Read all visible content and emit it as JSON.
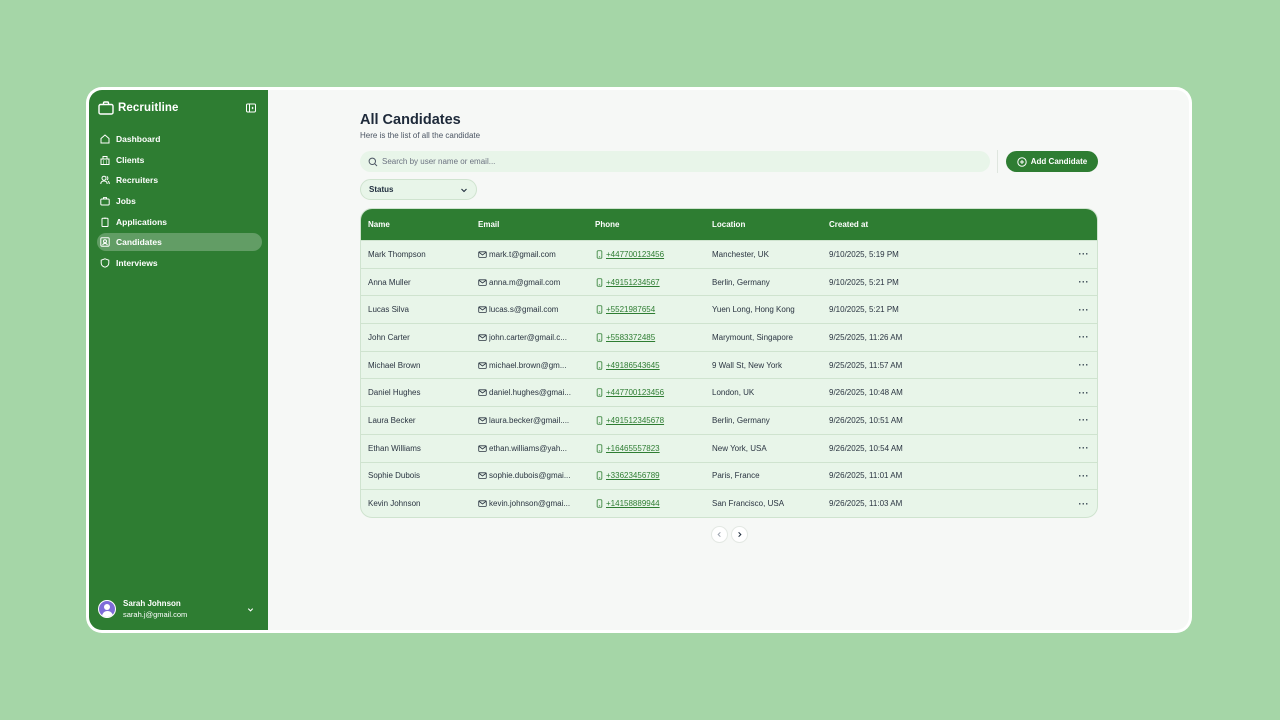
{
  "app": {
    "name": "Recruitline"
  },
  "sidebar": {
    "items": [
      {
        "label": "Dashboard",
        "icon": "home-icon"
      },
      {
        "label": "Clients",
        "icon": "building-icon"
      },
      {
        "label": "Recruiters",
        "icon": "users-icon"
      },
      {
        "label": "Jobs",
        "icon": "briefcase-icon"
      },
      {
        "label": "Applications",
        "icon": "clipboard-icon"
      },
      {
        "label": "Candidates",
        "icon": "contact-card-icon",
        "active": true
      },
      {
        "label": "Interviews",
        "icon": "shield-icon"
      }
    ]
  },
  "user": {
    "name": "Sarah Johnson",
    "email": "sarah.j@gmail.com"
  },
  "page": {
    "title": "All Candidates",
    "subtitle": "Here is the list of all the candidate",
    "search_placeholder": "Search by user name or email...",
    "add_button": "Add Candidate",
    "status_filter": "Status"
  },
  "table": {
    "headers": {
      "name": "Name",
      "email": "Email",
      "phone": "Phone",
      "location": "Location",
      "created": "Created at"
    },
    "rows": [
      {
        "name": "Mark Thompson",
        "email": "mark.t@gmail.com",
        "phone": "+447700123456",
        "location": "Manchester, UK",
        "created": "9/10/2025, 5:19 PM"
      },
      {
        "name": "Anna Muller",
        "email": "anna.m@gmail.com",
        "phone": "+49151234567",
        "location": "Berlin, Germany",
        "created": "9/10/2025, 5:21 PM"
      },
      {
        "name": "Lucas Silva",
        "email": "lucas.s@gmail.com",
        "phone": "+5521987654",
        "location": "Yuen Long, Hong Kong",
        "created": "9/10/2025, 5:21 PM"
      },
      {
        "name": "John Carter",
        "email": "john.carter@gmail.c...",
        "phone": "+5583372485",
        "location": "Marymount, Singapore",
        "created": "9/25/2025, 11:26 AM"
      },
      {
        "name": "Michael Brown",
        "email": "michael.brown@gm...",
        "phone": "+49186543645",
        "location": "9 Wall St, New York",
        "created": "9/25/2025, 11:57 AM"
      },
      {
        "name": "Daniel Hughes",
        "email": "daniel.hughes@gmai...",
        "phone": "+447700123456",
        "location": "London, UK",
        "created": "9/26/2025, 10:48 AM"
      },
      {
        "name": "Laura Becker",
        "email": "laura.becker@gmail....",
        "phone": "+491512345678",
        "location": "Berlin, Germany",
        "created": "9/26/2025, 10:51 AM"
      },
      {
        "name": "Ethan Williams",
        "email": "ethan.williams@yah...",
        "phone": "+16465557823",
        "location": "New York, USA",
        "created": "9/26/2025, 10:54 AM"
      },
      {
        "name": "Sophie Dubois",
        "email": "sophie.dubois@gmai...",
        "phone": "+33623456789",
        "location": "Paris, France",
        "created": "9/26/2025, 11:01 AM"
      },
      {
        "name": "Kevin Johnson",
        "email": "kevin.johnson@gmai...",
        "phone": "+14158889944",
        "location": "San Francisco, USA",
        "created": "9/26/2025, 11:03 AM"
      }
    ],
    "row_action": "···"
  },
  "colors": {
    "brand": "#2e7d32",
    "background": "#a5d6a7",
    "row_bg": "#e8f5e9"
  }
}
